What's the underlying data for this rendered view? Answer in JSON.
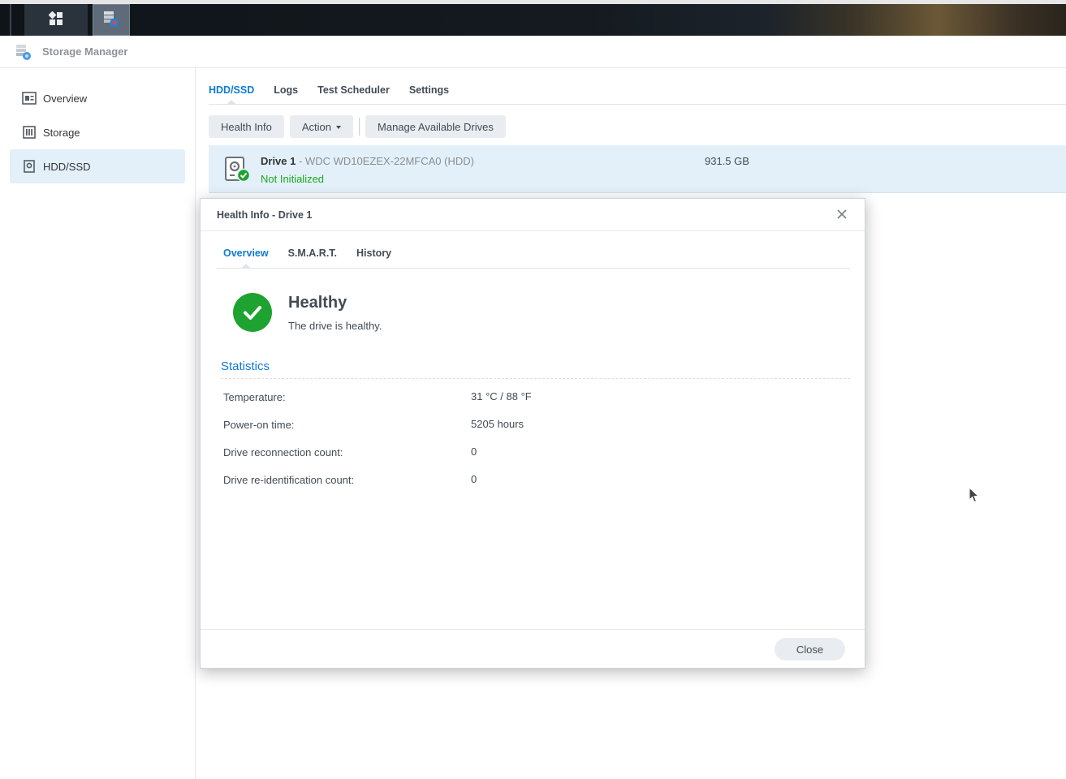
{
  "app": {
    "title": "Storage Manager"
  },
  "sidebar": {
    "items": [
      {
        "label": "Overview",
        "icon": "overview-icon"
      },
      {
        "label": "Storage",
        "icon": "storage-icon"
      },
      {
        "label": "HDD/SSD",
        "icon": "hdd-icon",
        "active": true
      }
    ]
  },
  "main": {
    "tabs": [
      {
        "label": "HDD/SSD",
        "active": true
      },
      {
        "label": "Logs"
      },
      {
        "label": "Test Scheduler"
      },
      {
        "label": "Settings"
      }
    ],
    "toolbar": {
      "health_info": "Health Info",
      "action": "Action",
      "manage": "Manage Available Drives"
    },
    "drive": {
      "name": "Drive 1",
      "model": " - WDC WD10EZEX-22MFCA0 (HDD)",
      "status": "Not Initialized",
      "size": "931.5 GB"
    }
  },
  "modal": {
    "title": "Health Info - Drive 1",
    "tabs": [
      {
        "label": "Overview",
        "active": true
      },
      {
        "label": "S.M.A.R.T."
      },
      {
        "label": "History"
      }
    ],
    "health": {
      "status": "Healthy",
      "description": "The drive is healthy."
    },
    "statistics": {
      "title": "Statistics",
      "rows": [
        {
          "label": "Temperature:",
          "value": "31 °C / 88 °F"
        },
        {
          "label": "Power-on time:",
          "value": "5205 hours"
        },
        {
          "label": "Drive reconnection count:",
          "value": "0"
        },
        {
          "label": "Drive re-identification count:",
          "value": "0"
        }
      ]
    },
    "close_label": "Close"
  },
  "colors": {
    "accent": "#0f7ad6",
    "healthy": "#1ea331",
    "status_text": "#1aaa1a",
    "selected_bg": "#e3f0fa"
  }
}
